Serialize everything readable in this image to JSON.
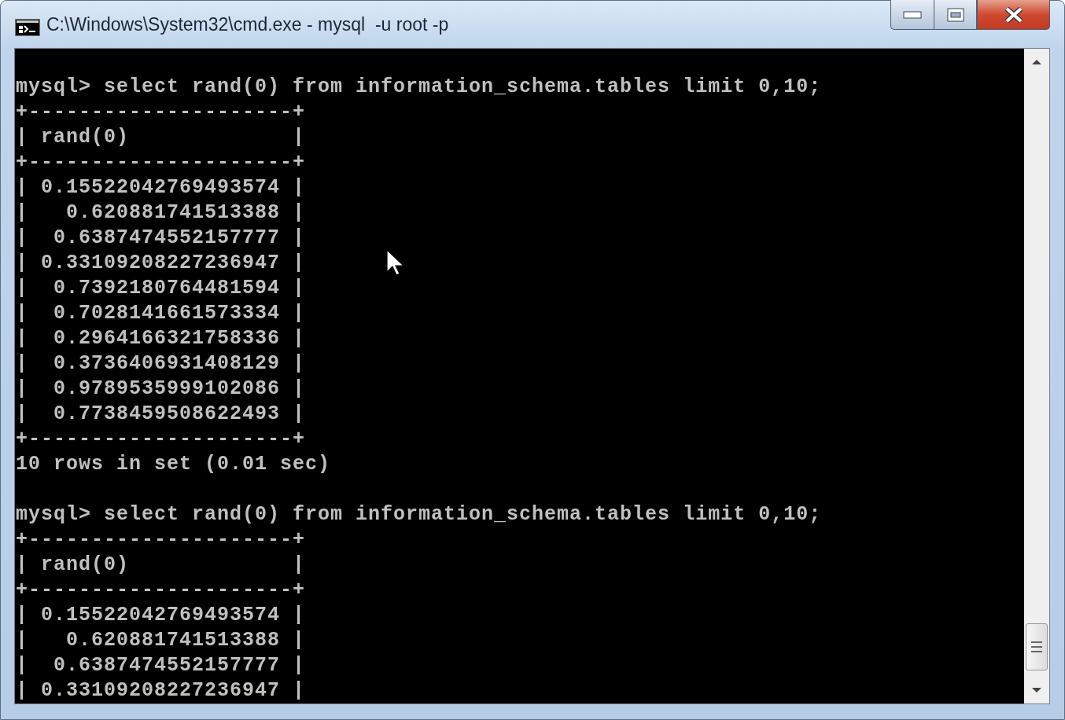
{
  "window": {
    "title": "C:\\Windows\\System32\\cmd.exe - mysql  -u root -p"
  },
  "console": {
    "blocks": [
      {
        "command": "mysql> select rand(0) from information_schema.tables limit 0,10;",
        "output": [
          "+---------------------+",
          "| rand(0)             |",
          "+---------------------+",
          "| 0.15522042769493574 |",
          "|   0.620881741513388 |",
          "|  0.6387474552157777 |",
          "| 0.33109208227236947 |",
          "|  0.7392180764481594 |",
          "|  0.7028141661573334 |",
          "|  0.2964166321758336 |",
          "|  0.3736406931408129 |",
          "|  0.9789535999102086 |",
          "|  0.7738459508622493 |",
          "+---------------------+",
          "10 rows in set (0.01 sec)"
        ]
      },
      {
        "command": "mysql> select rand(0) from information_schema.tables limit 0,10;",
        "output": [
          "+---------------------+",
          "| rand(0)             |",
          "+---------------------+",
          "| 0.15522042769493574 |",
          "|   0.620881741513388 |",
          "|  0.6387474552157777 |",
          "| 0.33109208227236947 |"
        ]
      }
    ]
  }
}
